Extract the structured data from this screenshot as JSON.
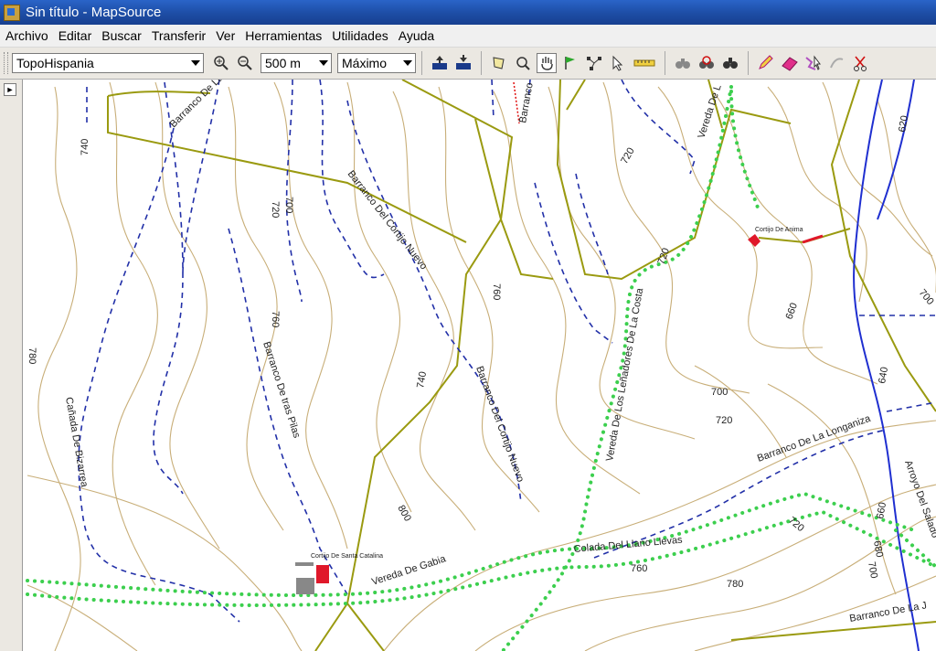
{
  "window": {
    "title": "Sin título - MapSource"
  },
  "menu": [
    "Archivo",
    "Editar",
    "Buscar",
    "Transferir",
    "Ver",
    "Herramientas",
    "Utilidades",
    "Ayuda"
  ],
  "toolbar": {
    "map_product": "TopoHispania",
    "zoom_scale": "500 m",
    "detail_level": "Máximo"
  },
  "map": {
    "contour_labels": [
      "740",
      "720",
      "700",
      "780",
      "760",
      "720",
      "760",
      "740",
      "800",
      "720",
      "660",
      "700",
      "720",
      "700",
      "640",
      "660",
      "620",
      "680",
      "700",
      "760",
      "780",
      "720"
    ],
    "stream_labels": {
      "barranco_de_la_top": "Barranco De La",
      "barranco_cortijo_nuevo_1": "Barranco Del Cortijo Nuevo",
      "barranco_top_mid": "Barranco",
      "barranco_tras_pilas": "Barranco De tras Pilas",
      "canada_bizarrea": "Cañada De Bizarrea",
      "barranco_cortijo_nuevo_2": "Barranco Del Cortijo Nuevo",
      "barranco_longaniza": "Barranco De La Longaniza",
      "arroyo_salado": "Arroyo Del Salado",
      "barranco_de_la_j": "Barranco De La J"
    },
    "trail_labels": {
      "vereda_top": "Vereda De L",
      "vereda_lenadores": "Vereda De Los Leñadores De La Costa",
      "vereda_gabia": "Vereda De Gabia",
      "colada_llano": "Colada Del Llano Llevas"
    },
    "poi_labels": {
      "cortijo_anima": "Cortijo De Anima",
      "cortijo_santa_catalina": "Cortijo De Santa Catalina"
    },
    "colors": {
      "contour": "#c8ae78",
      "stream": "#2230a8",
      "river": "#1f2fd0",
      "trail": "#3ccf4e",
      "road": "#9a9a10",
      "poi": "#e0182a"
    }
  }
}
